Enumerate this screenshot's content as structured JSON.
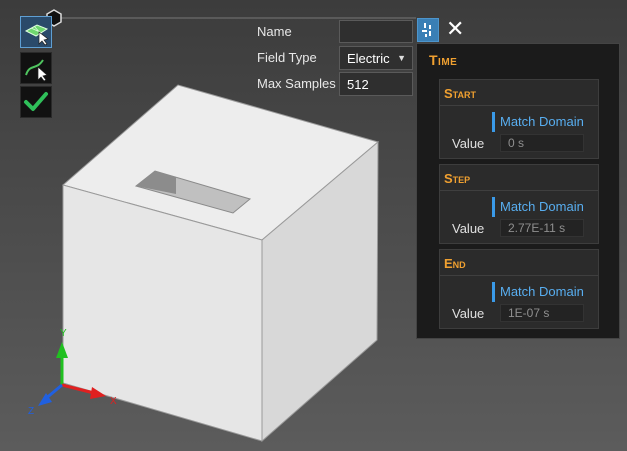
{
  "form": {
    "name_label": "Name",
    "name_value": "",
    "field_type_label": "Field Type",
    "field_type_value": "Electric",
    "max_samples_label": "Max Samples",
    "max_samples_value": "512"
  },
  "time_panel": {
    "title": "Time",
    "sections": [
      {
        "title": "Start",
        "match_label": "Match Domain",
        "value_label": "Value",
        "value": "0 s"
      },
      {
        "title": "Step",
        "match_label": "Match Domain",
        "value_label": "Value",
        "value": "2.77E-11 s"
      },
      {
        "title": "End",
        "match_label": "Match Domain",
        "value_label": "Value",
        "value": "1E-07 s"
      }
    ]
  },
  "axes": {
    "x": "X",
    "y": "Y",
    "z": "Z"
  },
  "colors": {
    "accent_orange": "#f0a030",
    "link_blue": "#58aef0",
    "confirm_green": "#2fbf5a",
    "axis_x": "#e02020",
    "axis_y": "#20c020",
    "axis_z": "#2060e0"
  },
  "icons": {
    "tool_1": "mesh-select-icon",
    "tool_2": "curve-select-icon",
    "tool_3": "checkmark-icon",
    "time_toggle": "time-settings-icon",
    "close": "close-icon"
  }
}
